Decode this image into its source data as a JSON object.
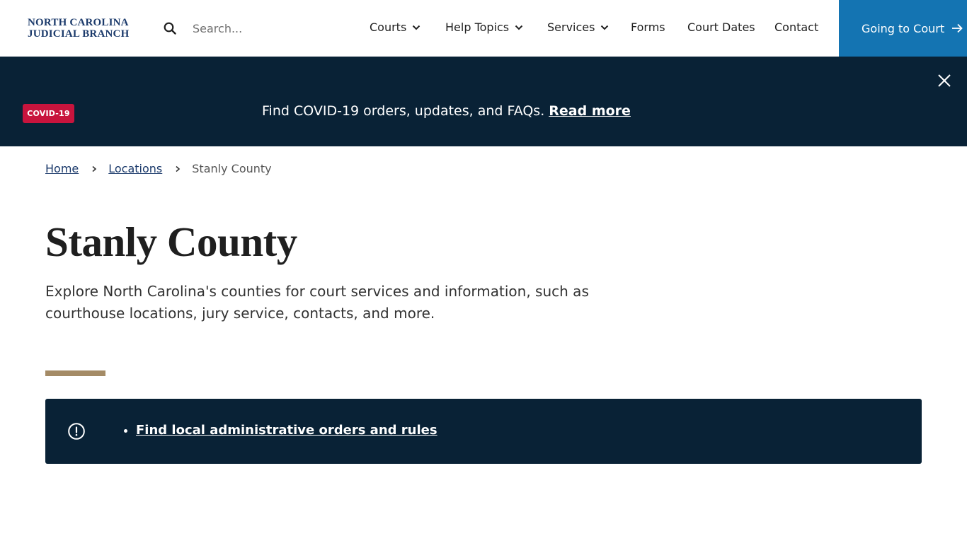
{
  "header": {
    "logo_line1": "NORTH CAROLINA",
    "logo_line2": "JUDICIAL BRANCH",
    "search_placeholder": "Search...",
    "nav": [
      {
        "label": "Courts",
        "has_dropdown": true
      },
      {
        "label": "Help Topics",
        "has_dropdown": true
      },
      {
        "label": "Services",
        "has_dropdown": true
      },
      {
        "label": "Forms",
        "has_dropdown": false
      },
      {
        "label": "Court Dates",
        "has_dropdown": false
      },
      {
        "label": "Contact",
        "has_dropdown": false
      }
    ],
    "cta_label": "Going to Court",
    "cta_icon": "arrow-right-icon"
  },
  "banner": {
    "badge": "COVID-19",
    "text": "Find COVID-19 orders, updates, and FAQs.",
    "link_label": "Read more",
    "close_icon": "close-icon"
  },
  "breadcrumb": {
    "items": [
      {
        "label": "Home",
        "link": true
      },
      {
        "label": "Locations",
        "link": true
      },
      {
        "label": "Stanly County",
        "link": false
      }
    ]
  },
  "main": {
    "title": "Stanly County",
    "intro": "Explore North Carolina's counties for court services and information, such as courthouse locations, jury service, contacts, and more.",
    "alert": {
      "icon": "exclamation-circle-icon",
      "links": [
        "Find local administrative orders and rules"
      ]
    }
  },
  "colors": {
    "brand_navy": "#092236",
    "cta_blue": "#1474b2",
    "badge_red": "#c8143d",
    "accent_tan": "#a48b66",
    "logo_blue": "#1b3a6b"
  }
}
